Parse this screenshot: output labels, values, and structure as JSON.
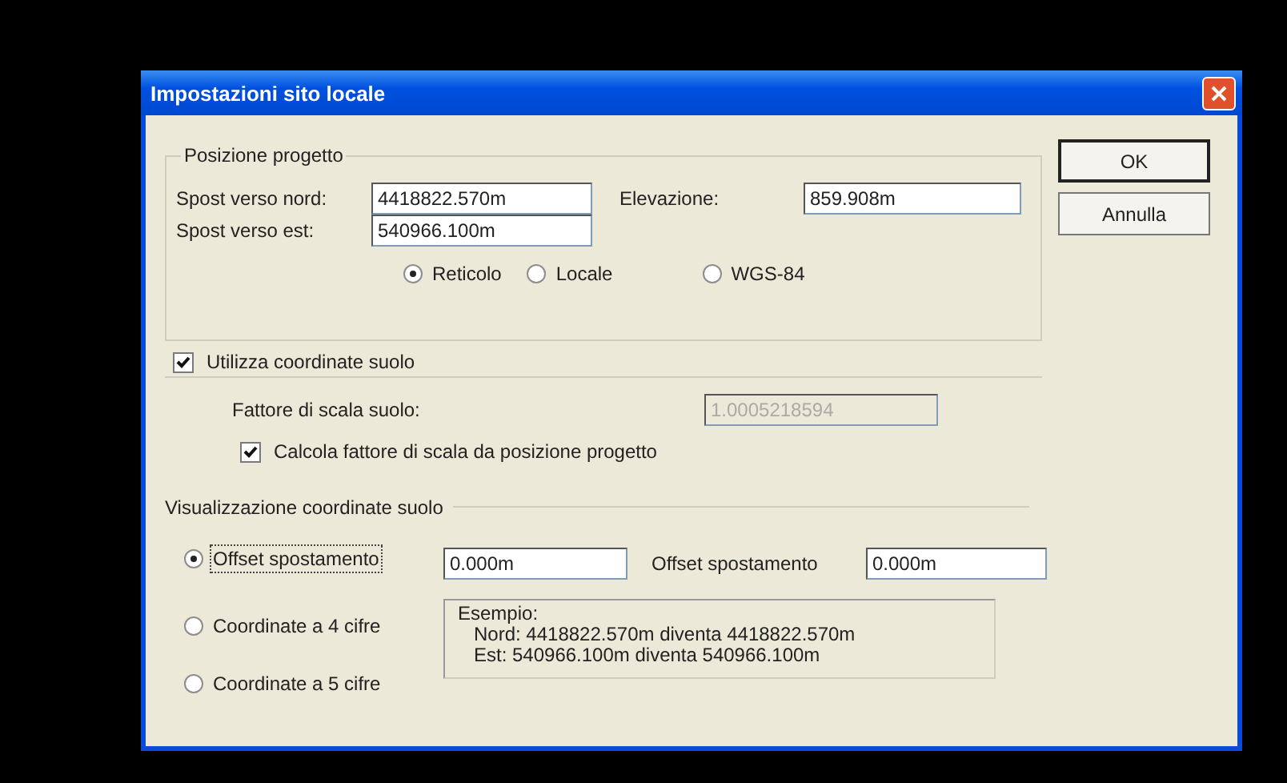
{
  "window": {
    "title": "Impostazioni sito locale"
  },
  "buttons": [
    {
      "label": "OK",
      "default": true
    },
    {
      "label": "Annulla",
      "default": false
    }
  ],
  "project_position": {
    "title": "Posizione progetto",
    "northing": {
      "label": "Spost verso nord:",
      "value": "4418822.570m"
    },
    "easting": {
      "label": "Spost verso est:",
      "value": "540966.100m"
    },
    "elevation": {
      "label": "Elevazione:",
      "value": "859.908m"
    },
    "coordinate_system": [
      {
        "label": "Reticolo",
        "selected": true
      },
      {
        "label": "Locale",
        "selected": false
      },
      {
        "label": "WGS-84",
        "selected": false
      }
    ]
  },
  "ground_coordinates": {
    "label": "Utilizza coordinate suolo",
    "checked": true,
    "scale_factor": {
      "label": "Fattore di scala suolo:",
      "value": "1.0005218594",
      "disabled": true
    },
    "compute_scale": {
      "label": "Calcola fattore di scala da posizione progetto",
      "checked": true
    }
  },
  "display": {
    "title": "Visualizzazione coordinate suolo",
    "options": [
      {
        "label": "Offset spostamento",
        "selected": true
      },
      {
        "label": "Coordinate a 4 cifre",
        "selected": false
      },
      {
        "label": "Coordinate a 5 cifre",
        "selected": false
      }
    ],
    "northing_offset": {
      "value": "0.000m"
    },
    "easting_offset": {
      "label": "Offset spostamento",
      "value": "0.000m"
    },
    "example": {
      "title": "Esempio:",
      "lines": [
        "Nord: 4418822.570m diventa 4418822.570m",
        "Est: 540966.100m diventa 540966.100m"
      ]
    }
  }
}
